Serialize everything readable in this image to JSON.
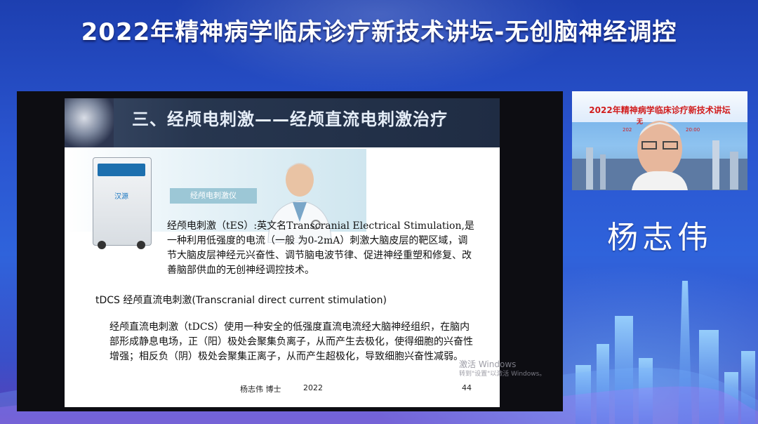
{
  "banner": {
    "title": "2022年精神病学临床诊疗新技术讲坛-无创脑神经调控"
  },
  "slide": {
    "title": "三、经颅电刺激——经颅直流电刺激治疗",
    "product_label": "经颅电刺激仪",
    "device_logo": "汉源",
    "paragraph_tes": "经颅电刺激（tES）:英文名Transcranial Electrical Stimulation,是一种利用低强度的电流（一般 为0-2mA）刺激大脑皮层的靶区域，调节大脑皮层神经元兴奋性、调节脑电波节律、促进神经重塑和修复、改 善脑部供血的无创神经调控技术。",
    "tdcs_heading": "tDCS  经颅直流电刺激(Transcranial direct current stimulation)",
    "paragraph_tdcs": "经颅直流电刺激（tDCS）使用一种安全的低强度直流电流经大脑神经组织，在脑内部形成静息电场，正（阳）极处会聚集负离子，从而产生去极化，使得细胞的兴奋性增强；相反负（阴）极处会聚集正离子，从而产生超极化，导致细胞兴奋性减弱。",
    "footer_author": "杨志伟  博士",
    "footer_year": "2022",
    "page_number": "44"
  },
  "windows_watermark": {
    "line1": "激活 Windows",
    "line2": "转到\"设置\"以激活 Windows。"
  },
  "webcam": {
    "banner_title": "2022年精神病学临床诊疗新技术讲坛",
    "banner_sub_left": "无",
    "banner_time_left": "202",
    "banner_time_right": "20:00"
  },
  "speaker": {
    "name": "杨志伟"
  },
  "colors": {
    "background_top": "#1d3fb0",
    "background_bottom": "#5a3fb8",
    "slide_header": "#27364f",
    "webcam_title_red": "#d11d1d"
  }
}
